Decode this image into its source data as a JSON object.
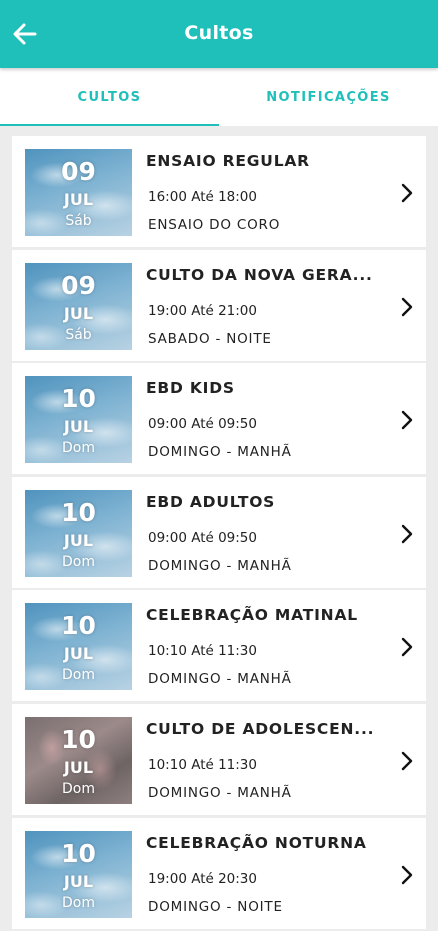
{
  "appbar": {
    "title": "Cultos",
    "back_icon": "arrow-left-icon"
  },
  "tabs": [
    {
      "label": "CULTOS",
      "active": true
    },
    {
      "label": "NOTIFICAÇÕES",
      "active": false
    }
  ],
  "colors": {
    "primary": "#1fbfba",
    "background": "#ececec",
    "card": "#ffffff",
    "text": "#222222"
  },
  "events": [
    {
      "day": "09",
      "month": "JUL",
      "weekday": "Sáb",
      "title": "ENSAIO REGULAR",
      "time": "16:00 Até 18:00",
      "subtitle": "ENSAIO DO CORO",
      "thumb": "sky"
    },
    {
      "day": "09",
      "month": "JUL",
      "weekday": "Sáb",
      "title": "CULTO DA NOVA GERA...",
      "time": "19:00 Até 21:00",
      "subtitle": "SABADO - NOITE",
      "thumb": "sky"
    },
    {
      "day": "10",
      "month": "JUL",
      "weekday": "Dom",
      "title": "EBD KIDS",
      "time": "09:00 Até 09:50",
      "subtitle": "DOMINGO - MANHÃ",
      "thumb": "sky"
    },
    {
      "day": "10",
      "month": "JUL",
      "weekday": "Dom",
      "title": "EBD ADULTOS",
      "time": "09:00 Até 09:50",
      "subtitle": "DOMINGO - MANHÃ",
      "thumb": "sky"
    },
    {
      "day": "10",
      "month": "JUL",
      "weekday": "Dom",
      "title": "CELEBRAÇÃO MATINAL",
      "time": "10:10 Até 11:30",
      "subtitle": "DOMINGO - MANHÃ",
      "thumb": "sky"
    },
    {
      "day": "10",
      "month": "JUL",
      "weekday": "Dom",
      "title": "CULTO DE ADOLESCEN...",
      "time": "10:10 Até 11:30",
      "subtitle": "DOMINGO - MANHÃ",
      "thumb": "photo"
    },
    {
      "day": "10",
      "month": "JUL",
      "weekday": "Dom",
      "title": "CELEBRAÇÃO NOTURNA",
      "time": "19:00 Até 20:30",
      "subtitle": "DOMINGO - NOITE",
      "thumb": "sky"
    }
  ]
}
